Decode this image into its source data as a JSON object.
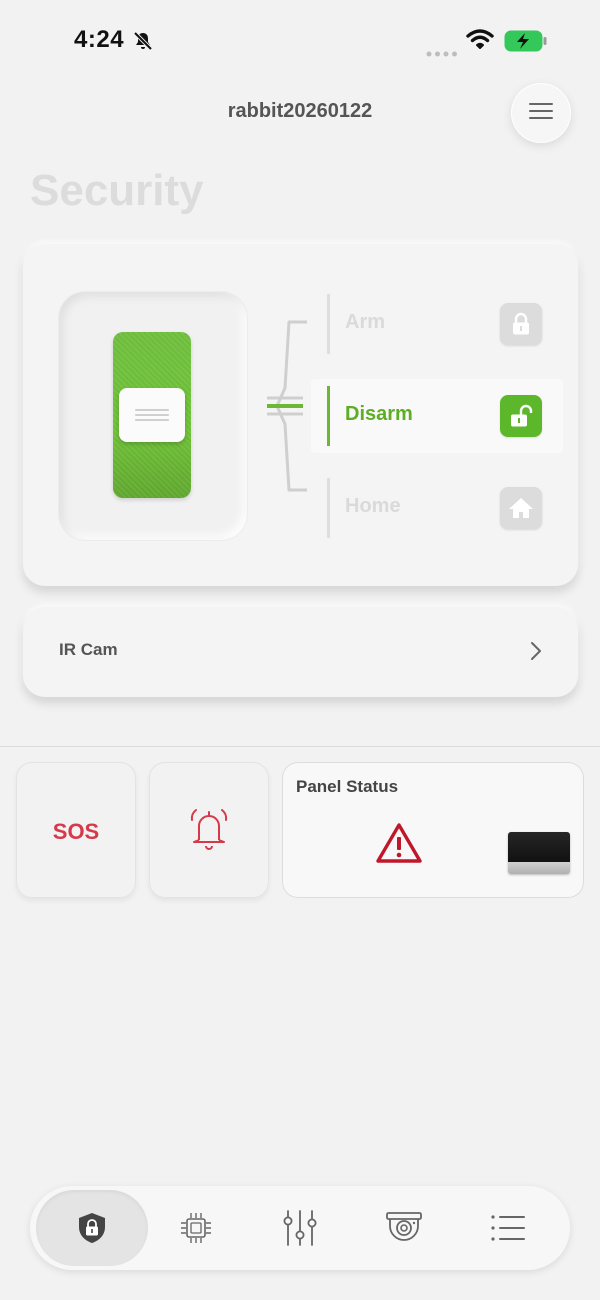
{
  "status_bar": {
    "time": "4:24",
    "icons": [
      "bell-slash-icon",
      "signal-dots-icon",
      "wifi-icon",
      "battery-charging-icon"
    ]
  },
  "header": {
    "account_name": "rabbit20260122",
    "menu_icon": "hamburger-menu-icon"
  },
  "page": {
    "title": "Security"
  },
  "security": {
    "switch_state": "Disarm",
    "modes": [
      {
        "label": "Arm",
        "icon": "lock-icon",
        "active": false
      },
      {
        "label": "Disarm",
        "icon": "unlock-icon",
        "active": true
      },
      {
        "label": "Home",
        "icon": "home-icon",
        "active": false
      }
    ]
  },
  "ir_cam": {
    "label": "IR Cam"
  },
  "tiles": {
    "sos_label": "SOS",
    "alarm_icon": "alarm-bell-icon",
    "panel_status_title": "Panel Status",
    "panel_status_icon": "warning-triangle-icon"
  },
  "tabs": [
    {
      "name": "security",
      "icon": "shield-lock-icon",
      "active": true
    },
    {
      "name": "devices",
      "icon": "chip-icon",
      "active": false
    },
    {
      "name": "controls",
      "icon": "sliders-icon",
      "active": false
    },
    {
      "name": "camera",
      "icon": "dome-camera-icon",
      "active": false
    },
    {
      "name": "more",
      "icon": "list-icon",
      "active": false
    }
  ],
  "colors": {
    "accent_green": "#5eae25",
    "sos_red": "#d63a4a",
    "warning_red": "#c0172b",
    "background": "#f2f2f2"
  }
}
